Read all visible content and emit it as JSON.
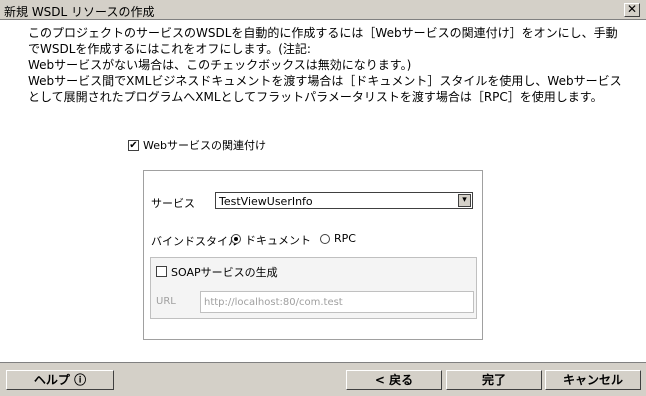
{
  "window": {
    "title": "新規 WSDL リソースの作成",
    "close_glyph": "✕"
  },
  "description": {
    "lines": [
      "このプロジェクトのサービスのWSDLを自動的に作成するには［Webサービスの関連付け］をオンにし、手動",
      "でWSDLを作成するにはこれをオフにします。(注記:",
      "Webサービスがない場合は、このチェックボックスは無効になります。)",
      "Webサービス間でXMLビジネスドキュメントを渡す場合は［ドキュメント］スタイルを使用し、Webサービス",
      "として展開されたプログラムへXMLとしてフラットパラメータリストを渡す場合は［RPC］を使用します。"
    ]
  },
  "associate": {
    "label": "Webサービスの関連付け",
    "checked": true,
    "check_glyph": "✔"
  },
  "service": {
    "label": "サービス",
    "value": "TestViewUserInfo",
    "dropdown_glyph": "▾"
  },
  "binding": {
    "label": "バインドスタイル",
    "options": [
      {
        "label": "ドキュメント",
        "selected": true
      },
      {
        "label": "RPC",
        "selected": false
      }
    ]
  },
  "soap": {
    "label": "SOAPサービスの生成",
    "checked": false,
    "url_label": "URL",
    "url_value": "http://localhost:80/com.test"
  },
  "buttons": {
    "help": "ヘルプ ⓘ",
    "back": "< 戻る",
    "finish": "完了",
    "cancel": "キャンセル"
  },
  "colors": {
    "dialog_bg": "#d4d0c8",
    "content_bg": "#ffffff",
    "disabled_text": "#a0a0a0"
  }
}
